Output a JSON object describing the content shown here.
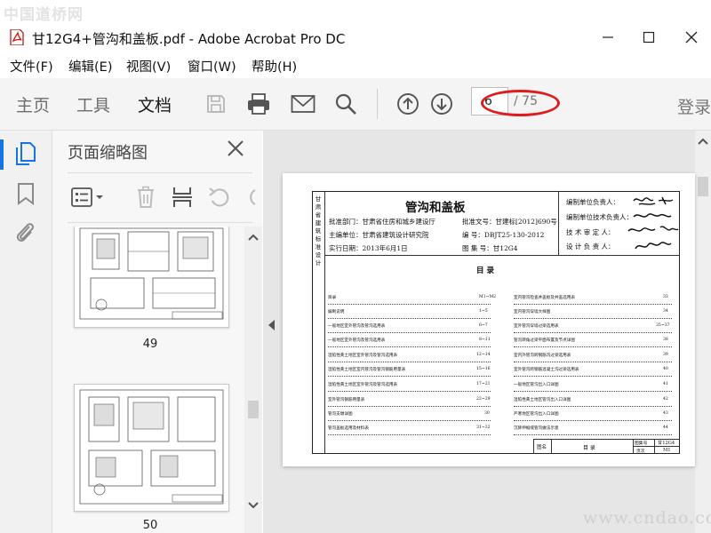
{
  "watermark_top": "中国道桥网",
  "watermark_bottom": "www.cndao.com",
  "window": {
    "title": "甘12G4+管沟和盖板.pdf - Adobe Acrobat Pro DC"
  },
  "menu": [
    "文件(F)",
    "编辑(E)",
    "视图(V)",
    "窗口(W)",
    "帮助(H)"
  ],
  "toolbar": {
    "tabs": [
      "主页",
      "工具",
      "文档"
    ],
    "page_current": "6",
    "page_total": "/ 75",
    "login": "登录"
  },
  "thumbnails": {
    "title": "页面缩略图",
    "pages": [
      "49",
      "50"
    ]
  },
  "document": {
    "title": "管沟和盖板",
    "info_left": [
      "批准部门：甘肃省住房和城乡建设厅",
      "主编单位：甘肃省建筑设计研究院",
      "实行日期：2013年6月1日"
    ],
    "info_right": [
      "批准文号：甘建标[2012]690号",
      "编    号：DBJT25-130-2012",
      "图 集 号：甘12G4"
    ],
    "sign_labels": [
      "编制单位负责人：",
      "编制单位技术负责人：",
      "技 术 审 定 人：",
      "设 计 负 责 人："
    ],
    "side_label": "甘 肃 省 建 筑 标 准 设 计",
    "toc_heading": "目    录",
    "toc_left": [
      {
        "t": "目录",
        "p": "M1~M2"
      },
      {
        "t": "编制说明",
        "p": "1~5"
      },
      {
        "t": "一般地区室外管沟及管沟选用表",
        "p": "6~7"
      },
      {
        "t": "一般地区室外管沟及管沟选用表",
        "p": "8~11"
      },
      {
        "t": "湿陷性黄土地区室外管沟及管沟选用表",
        "p": "12~14"
      },
      {
        "t": "湿陷性黄土地区室内管沟及管沟钢筋用量表",
        "p": "15~16"
      },
      {
        "t": "湿陷性黄土地区室外管沟及管沟选用表",
        "p": "17~21"
      },
      {
        "t": "室外管沟钢筋用量表",
        "p": "22~29"
      },
      {
        "t": "管沟支墩详图",
        "p": "30"
      },
      {
        "t": "管沟盖板选用及材料表",
        "p": "31~32"
      }
    ],
    "toc_right": [
      {
        "t": "室内管沟检查井盖板及井盖选用表",
        "p": "33"
      },
      {
        "t": "室内管沟穿墙大样图",
        "p": "34"
      },
      {
        "t": "室外管沟穿墙过梁选用表",
        "p": "35~37"
      },
      {
        "t": "管沟转角过梁平面布置及节点详图",
        "p": "38"
      },
      {
        "t": "室内外管沟跨钢筋沟过梁选用表",
        "p": "39"
      },
      {
        "t": "室外管沟跨钢筋混凝土沟过梁选用表",
        "p": "40"
      },
      {
        "t": "一般地区管沟出入口详图",
        "p": "41"
      },
      {
        "t": "湿陷性黄土地区管沟出入口详图",
        "p": "42"
      },
      {
        "t": "严寒地区管沟出入口详图",
        "p": "43"
      },
      {
        "t": "沉降伸缩缝管沟做法示意",
        "p": "44"
      }
    ],
    "footer": {
      "label_name": "图名",
      "name": "目    录",
      "label_atlas": "图集号",
      "atlas": "甘12G4",
      "label_page": "页次",
      "page": "M1"
    }
  },
  "colors": {
    "highlight": "#e01b1b",
    "accent_blue": "#1473e6"
  }
}
